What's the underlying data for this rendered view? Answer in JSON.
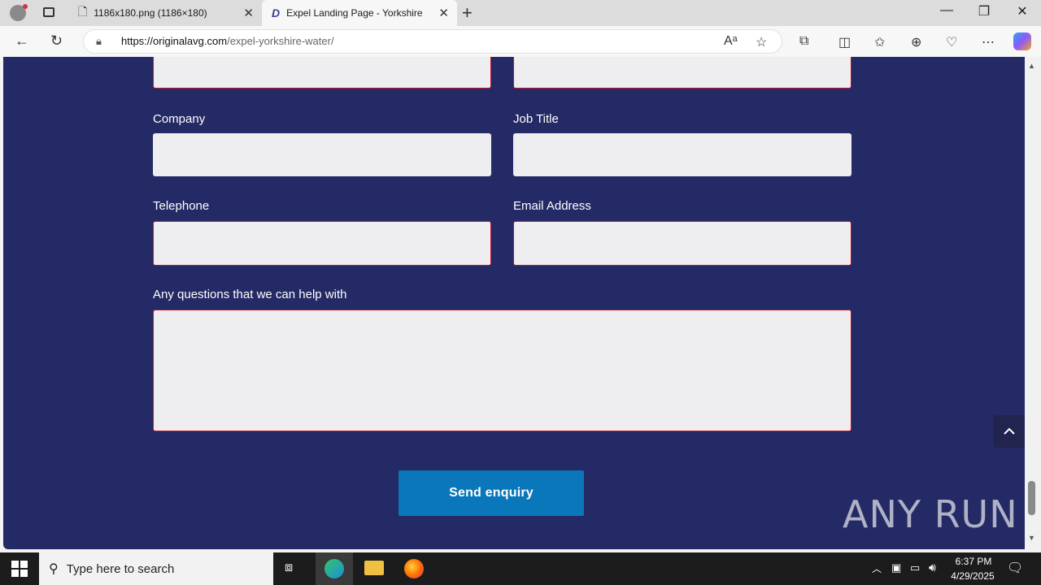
{
  "browser": {
    "tabs": [
      {
        "title": "1186x180.png (1186×180)"
      },
      {
        "title": "Expel Landing Page - Yorkshire W"
      }
    ],
    "url_domain": "https://originalavg.com",
    "url_path": "/expel-yorkshire-water/"
  },
  "form": {
    "company_label": "Company",
    "job_title_label": "Job Title",
    "telephone_label": "Telephone",
    "email_label": "Email Address",
    "questions_label": "Any questions that we can help with",
    "submit_label": "Send enquiry"
  },
  "watermark": "ANY RUN",
  "taskbar": {
    "search_placeholder": "Type here to search",
    "time": "6:37 PM",
    "date": "4/29/2025"
  }
}
